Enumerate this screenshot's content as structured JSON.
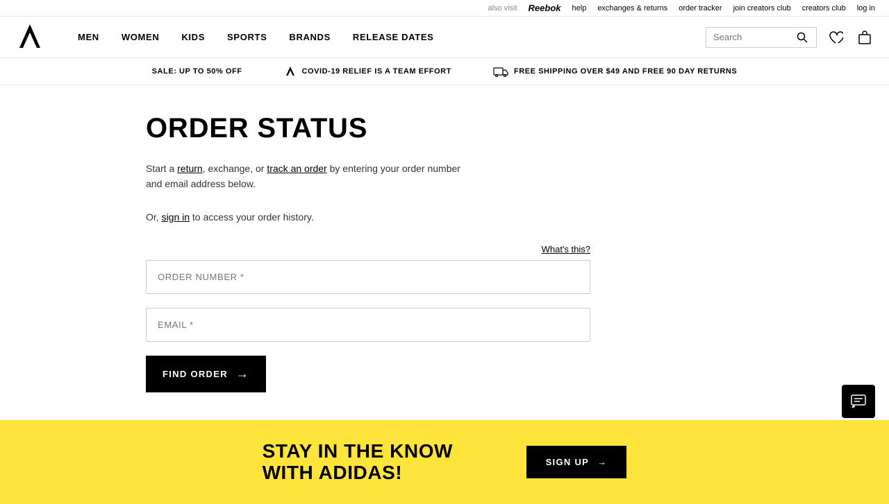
{
  "topbar": {
    "also_visit": "also visit",
    "reebok": "Reebok",
    "help": "help",
    "exchanges_returns": "exchanges & returns",
    "order_tracker": "order tracker",
    "join_creators_club": "join creators club",
    "creators_club": "creators club",
    "log_in": "log in"
  },
  "nav": {
    "logo_alt": "adidas logo",
    "links": [
      {
        "label": "MEN",
        "id": "men"
      },
      {
        "label": "WOMEN",
        "id": "women"
      },
      {
        "label": "KIDS",
        "id": "kids"
      },
      {
        "label": "SPORTS",
        "id": "sports"
      },
      {
        "label": "BRANDS",
        "id": "brands"
      },
      {
        "label": "RELEASE DATES",
        "id": "release-dates"
      }
    ],
    "search_placeholder": "Search"
  },
  "promo": {
    "items": [
      {
        "id": "sale",
        "text": "SALE: UP TO 50% OFF",
        "icon": ""
      },
      {
        "id": "covid",
        "text": "COVID-19 RELIEF IS A TEAM EFFORT",
        "icon": "adidas"
      },
      {
        "id": "shipping",
        "text": "FREE SHIPPING OVER $49 AND FREE 90 DAY RETURNS",
        "icon": "truck"
      }
    ]
  },
  "main": {
    "title": "ORDER STATUS",
    "description_part1": "Start a ",
    "return_link": "return",
    "description_part2": ", exchange, or ",
    "track_link": "track an order",
    "description_part3": " by entering your order number and email address below.",
    "sign_in_prefix": "Or, ",
    "sign_in_link": "sign in",
    "sign_in_suffix": " to access your order history.",
    "what_this": "What's this?",
    "order_number_placeholder": "ORDER NUMBER *",
    "email_placeholder": "EMAIL *",
    "find_order_label": "FIND ORDER"
  },
  "footer": {
    "promo_title": "STAY IN THE KNOW WITH ADIDAS!",
    "signup_label": "SIGN UP"
  }
}
